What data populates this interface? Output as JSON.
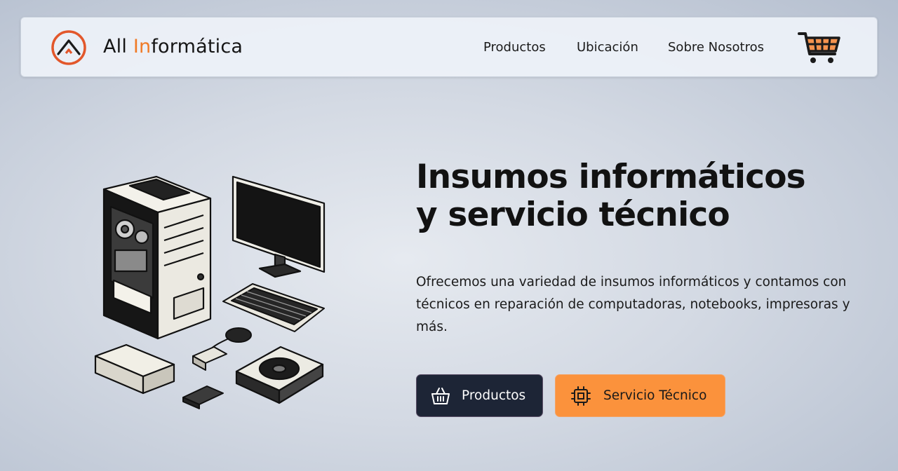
{
  "nav": {
    "brand_prefix": "All ",
    "brand_accent": "In",
    "brand_suffix": "formática",
    "links": [
      "Productos",
      "Ubicación",
      "Sobre Nosotros"
    ],
    "cart_icon": "shopping-cart-icon",
    "logo_icon": "mountain-circle-logo-icon"
  },
  "hero": {
    "title_line1": "Insumos informáticos",
    "title_line2": "y servicio técnico",
    "description": "Ofrecemos una variedad de insumos informáticos y contamos con técnicos en reparación de computadoras, notebooks, impresoras y más.",
    "illustration": "computer-hardware-illustration",
    "buttons": {
      "products_label": "Productos",
      "products_icon": "basket-icon",
      "service_label": "Servicio Técnico",
      "service_icon": "cpu-chip-icon"
    }
  },
  "colors": {
    "accent": "#f07a26",
    "button_dark": "#1d2536",
    "button_orange": "#fb923c"
  }
}
